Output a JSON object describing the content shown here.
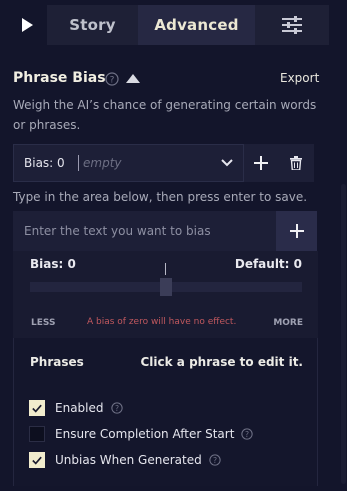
{
  "tabs": {
    "story": "Story",
    "advanced": "Advanced"
  },
  "header": {
    "title": "Phrase Bias",
    "export": "Export",
    "description": "Weigh the AI’s chance of generating certain words or phrases."
  },
  "bias_selector": {
    "label": "Bias: 0",
    "empty": "empty"
  },
  "hint": "Type in the area below, then press enter to save.",
  "bias_input": {
    "placeholder": "Enter the text you want to bias",
    "value": ""
  },
  "slider": {
    "bias_label": "Bias:",
    "bias_value": "0",
    "default_label": "Default: 0",
    "less": "LESS",
    "more": "MORE",
    "zero_note": "A bias of zero will have no effect.",
    "position_fraction": 0.5
  },
  "phrases": {
    "label": "Phrases",
    "hint": "Click a phrase to edit it."
  },
  "options": [
    {
      "label": "Enabled",
      "checked": true
    },
    {
      "label": "Ensure Completion After Start",
      "checked": false
    },
    {
      "label": "Unbias When Generated",
      "checked": true
    }
  ],
  "colors": {
    "background": "#13152b",
    "accent_cream": "#f1eccd",
    "warning": "#c0585e"
  }
}
